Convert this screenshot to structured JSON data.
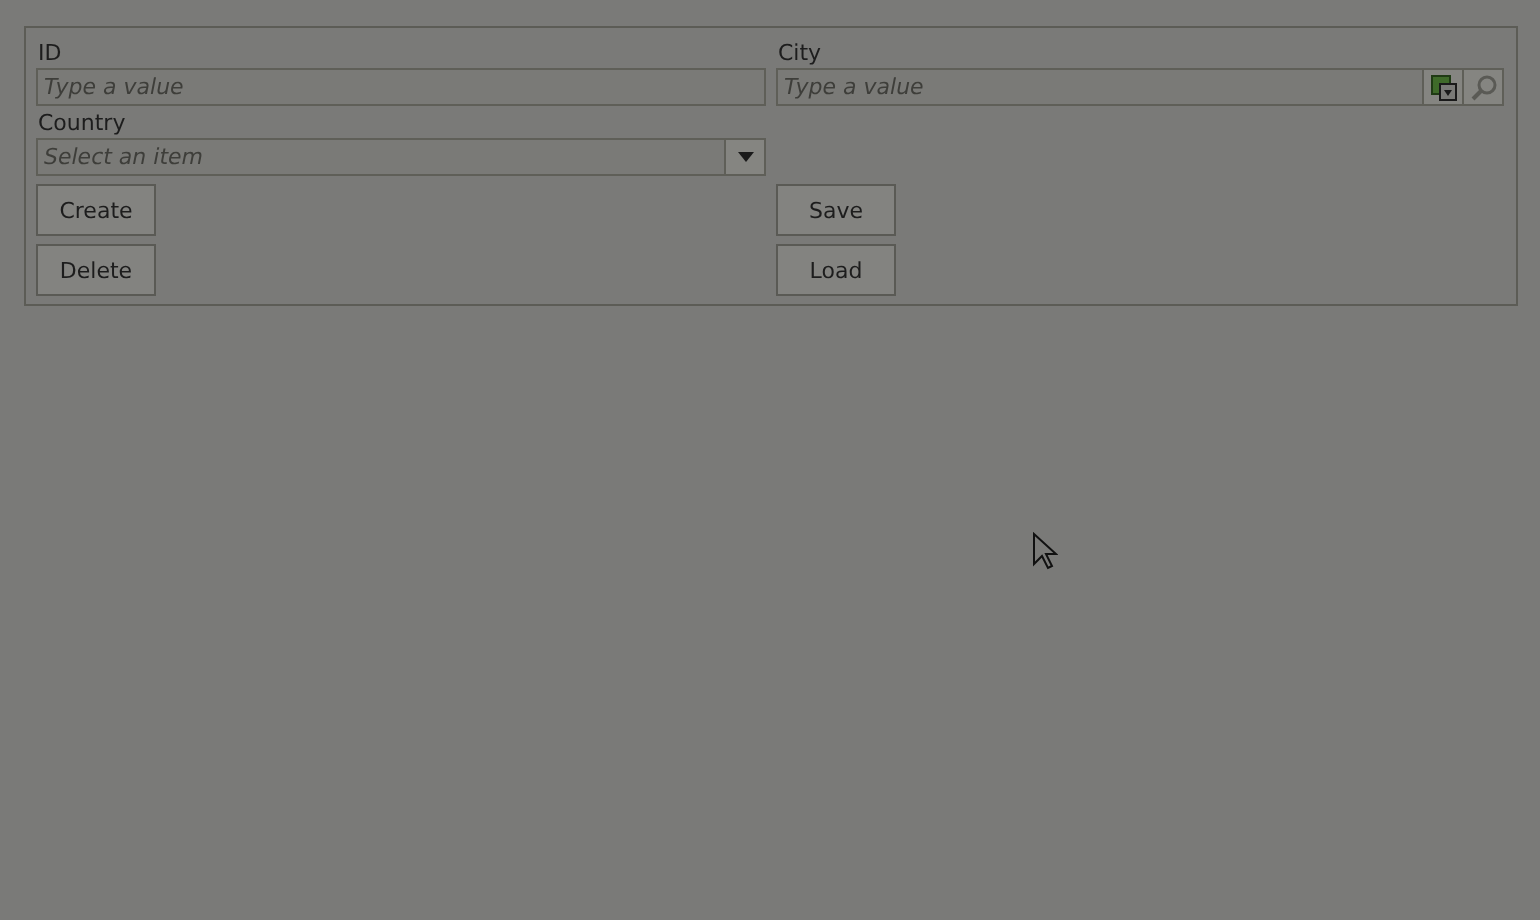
{
  "form": {
    "fields": [
      {
        "label": "ID",
        "placeholder": "Type a value",
        "kind": "text"
      },
      {
        "label": "City",
        "placeholder": "Type a value",
        "kind": "lookup"
      },
      {
        "label": "Country",
        "placeholder": "Select an item",
        "kind": "select"
      }
    ],
    "left_buttons": [
      "Create",
      "Delete"
    ],
    "right_buttons": [
      "Save",
      "Load"
    ]
  }
}
